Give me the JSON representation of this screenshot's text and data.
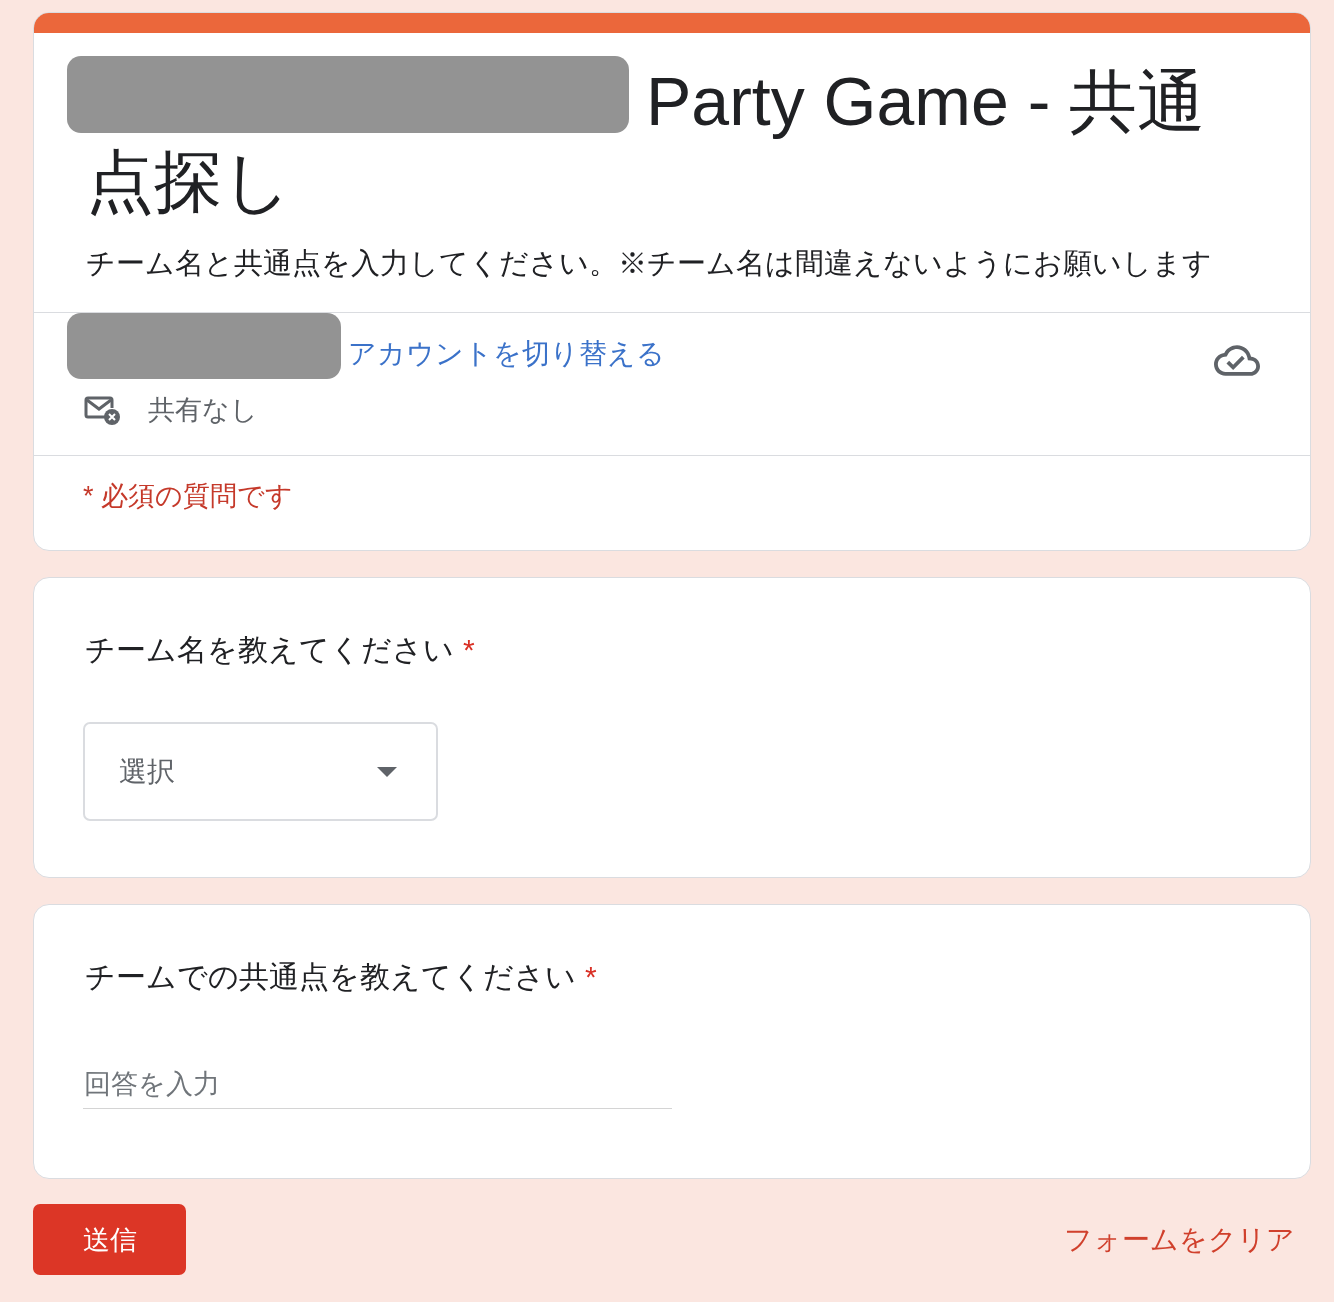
{
  "header": {
    "redacted_prefix": true,
    "title": "Party Game - 共通点探し",
    "description": "チーム名と共通点を入力してください。※チーム名は間違えないようにお願いします"
  },
  "account": {
    "redacted_email": true,
    "switch_link": "アカウントを切り替える",
    "sharing": "共有なし"
  },
  "required_note": "* 必須の質問です",
  "questions": [
    {
      "kind": "dropdown",
      "title": "チーム名を教えてください",
      "required_mark": "*",
      "placeholder": "選択"
    },
    {
      "kind": "text",
      "title": "チームでの共通点を教えてください",
      "required_mark": "*",
      "placeholder": "回答を入力"
    }
  ],
  "actions": {
    "submit": "送信",
    "clear": "フォームをクリア"
  }
}
